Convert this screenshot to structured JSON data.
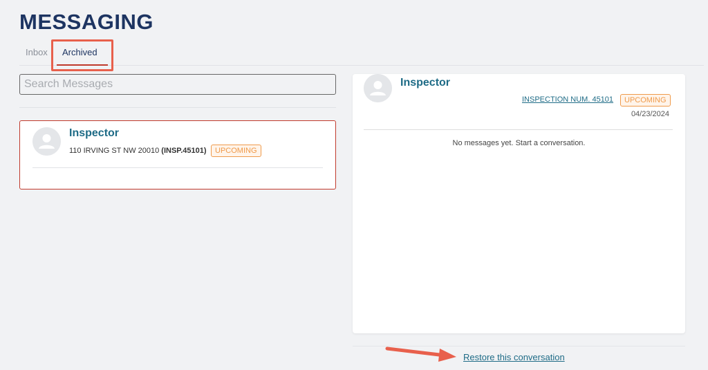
{
  "page": {
    "title": "MESSAGING"
  },
  "tabs": [
    {
      "label": "Inbox",
      "active": false
    },
    {
      "label": "Archived",
      "active": true
    }
  ],
  "search": {
    "placeholder": "Search Messages",
    "value": ""
  },
  "conversations": [
    {
      "name": "Inspector",
      "address": "110 IRVING ST NW 20010",
      "inspection": "(INSP.45101)",
      "status": "UPCOMING",
      "avatar_icon": "user-icon"
    }
  ],
  "detail": {
    "name": "Inspector",
    "inspection_link": "INSPECTION NUM. 45101",
    "status": "UPCOMING",
    "date": "04/23/2024",
    "empty_message": "No messages yet. Start a conversation.",
    "avatar_icon": "user-icon"
  },
  "footer": {
    "restore_label": "Restore this conversation"
  },
  "colors": {
    "title": "#1d3461",
    "accent_teal": "#1e6b86",
    "active_red": "#c0392b",
    "badge_orange": "#ef9a4a",
    "annotation_red": "#e8604c"
  }
}
